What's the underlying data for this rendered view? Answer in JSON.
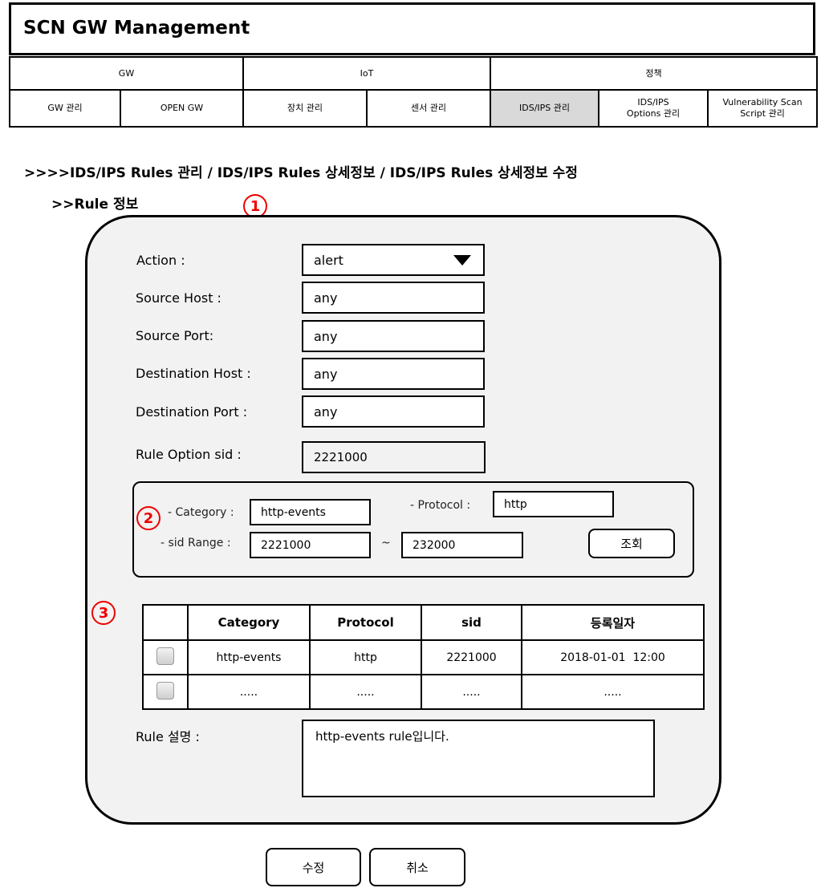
{
  "app": {
    "title": "SCN GW Management"
  },
  "nav": {
    "groups": [
      "GW",
      "IoT",
      "정책"
    ],
    "tabs": [
      {
        "label": "GW 관리"
      },
      {
        "label": "OPEN GW"
      },
      {
        "label": "장치 관리"
      },
      {
        "label": "센서 관리"
      },
      {
        "label": "IDS/IPS 관리",
        "active": true
      },
      {
        "label": "IDS/IPS\nOptions 관리"
      },
      {
        "label": "Vulnerability Scan\nScript 관리"
      }
    ]
  },
  "breadcrumb": ">>>>IDS/IPS Rules 관리 / IDS/IPS Rules  상세정보 / IDS/IPS Rules  상세정보 수정",
  "section_title": ">>Rule 정보",
  "markers": [
    "1",
    "2",
    "3"
  ],
  "form": {
    "action_label": "Action :",
    "action_value": "alert",
    "source_host_label": "Source Host :",
    "source_host_value": "any",
    "source_port_label": "Source Port:",
    "source_port_value": "any",
    "dest_host_label": "Destination Host :",
    "dest_host_value": "any",
    "dest_port_label": "Destination Port :",
    "dest_port_value": "any",
    "sid_label": "Rule Option sid :",
    "sid_value": "2221000"
  },
  "search": {
    "category_label": "- Category :",
    "category_value": "http-events",
    "protocol_label": "- Protocol :",
    "protocol_value": "http",
    "range_label": "- sid Range :",
    "range_from": "2221000",
    "range_sep": "~",
    "range_to": "232000",
    "search_button": "조회"
  },
  "results": {
    "columns": [
      "",
      "Category",
      "Protocol",
      "sid",
      "등록일자"
    ],
    "rows": [
      {
        "category": "http-events",
        "protocol": "http",
        "sid": "2221000",
        "date": "2018-01-01  12:00"
      },
      {
        "category": ".....",
        "protocol": ".....",
        "sid": ".....",
        "date": "....."
      }
    ]
  },
  "description": {
    "label": "Rule 설명 :",
    "value": "http-events rule입니다."
  },
  "buttons": {
    "modify": "수정",
    "cancel": "취소"
  },
  "colors": {
    "panel_bg": "#f2f2f2",
    "active_tab": "#d9d9d9",
    "marker": "#e00000"
  }
}
